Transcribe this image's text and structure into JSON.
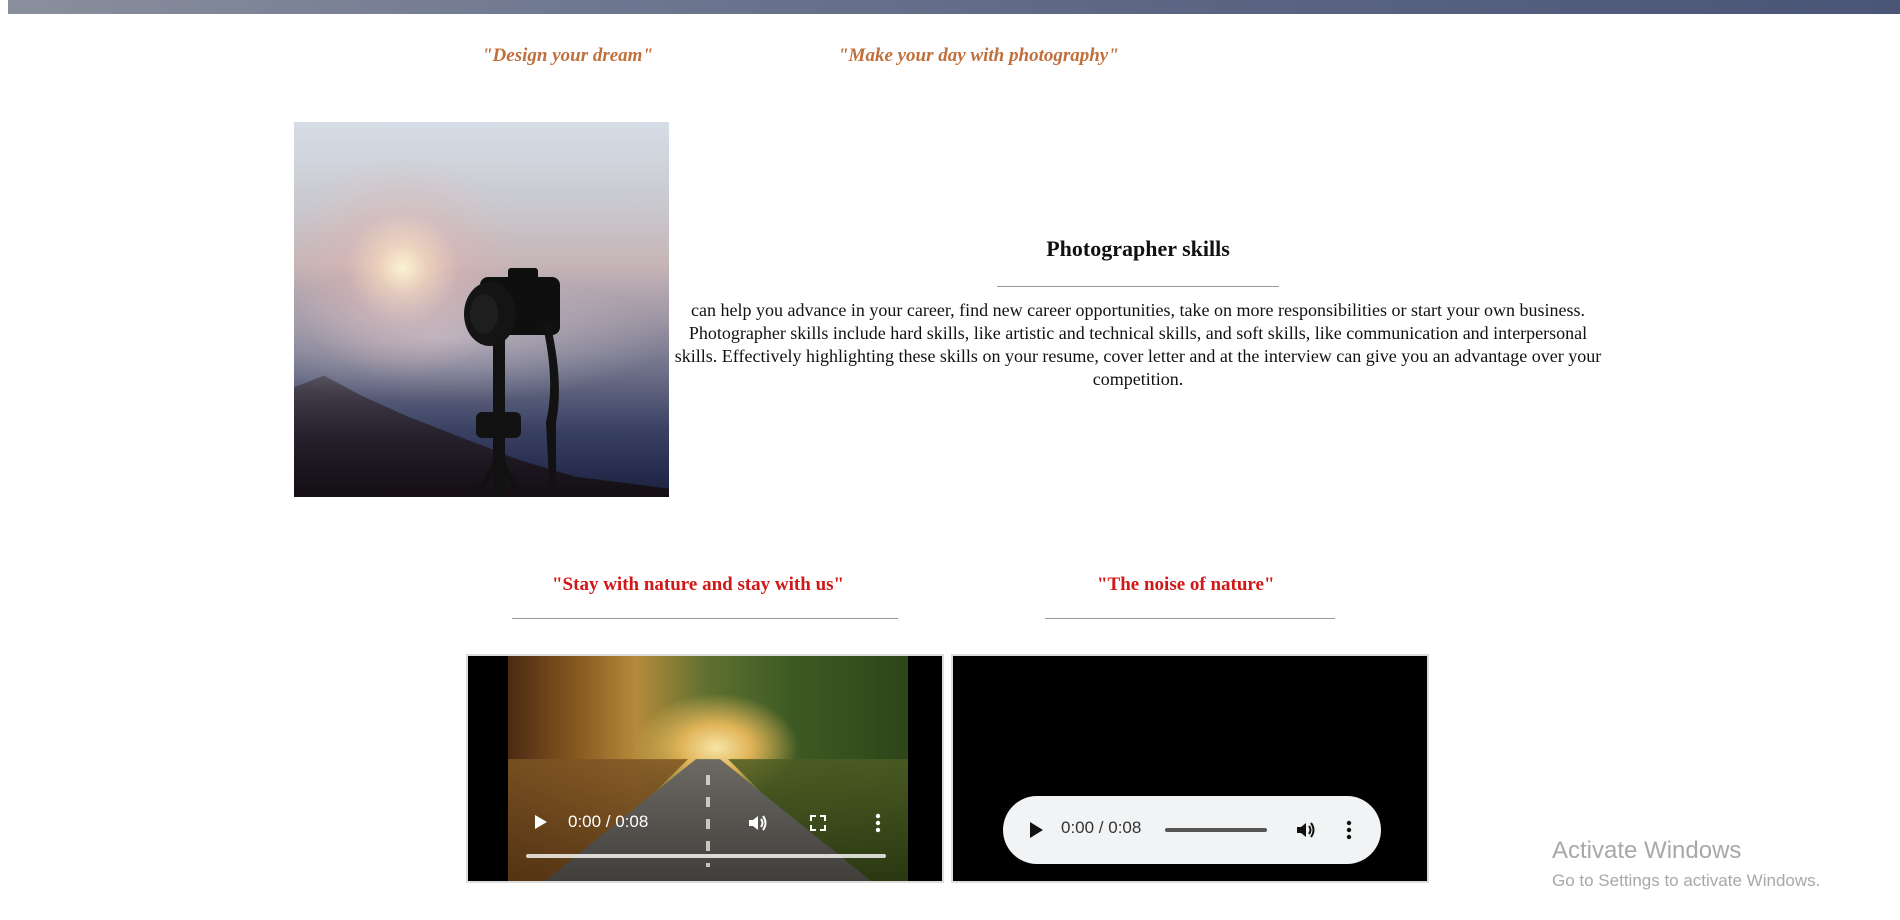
{
  "header": {
    "quote_left": "\"Design your dream\"",
    "quote_right": "\"Make your day with photography\""
  },
  "skills": {
    "title": "Photographer skills",
    "body": "can help you advance in your career, find new career opportunities, take on more responsibilities or start your own business. Photographer skills include hard skills, like artistic and technical skills, and soft skills, like communication and interpersonal skills. Effectively highlighting these skills on your resume, cover letter and at the interview can give you an advantage over your competition."
  },
  "media": {
    "video_heading": "\"Stay with nature and stay with us\"",
    "audio_heading": "\"The noise of nature\"",
    "video_time": "0:00 / 0:08",
    "audio_time": "0:00 / 0:08"
  },
  "watermark": {
    "line1": "Activate Windows",
    "line2": "Go to Settings to activate Windows."
  },
  "icons": {
    "video_controls": [
      "play-icon",
      "volume-icon",
      "fullscreen-icon",
      "more-options-icon"
    ],
    "audio_controls": [
      "play-icon",
      "volume-icon",
      "more-options-icon"
    ]
  },
  "colors": {
    "quote_orange": "#c0703c",
    "quote_red": "#d01818",
    "audio_player_bg": "#f1f3f4",
    "top_bar": "#5d6784"
  }
}
